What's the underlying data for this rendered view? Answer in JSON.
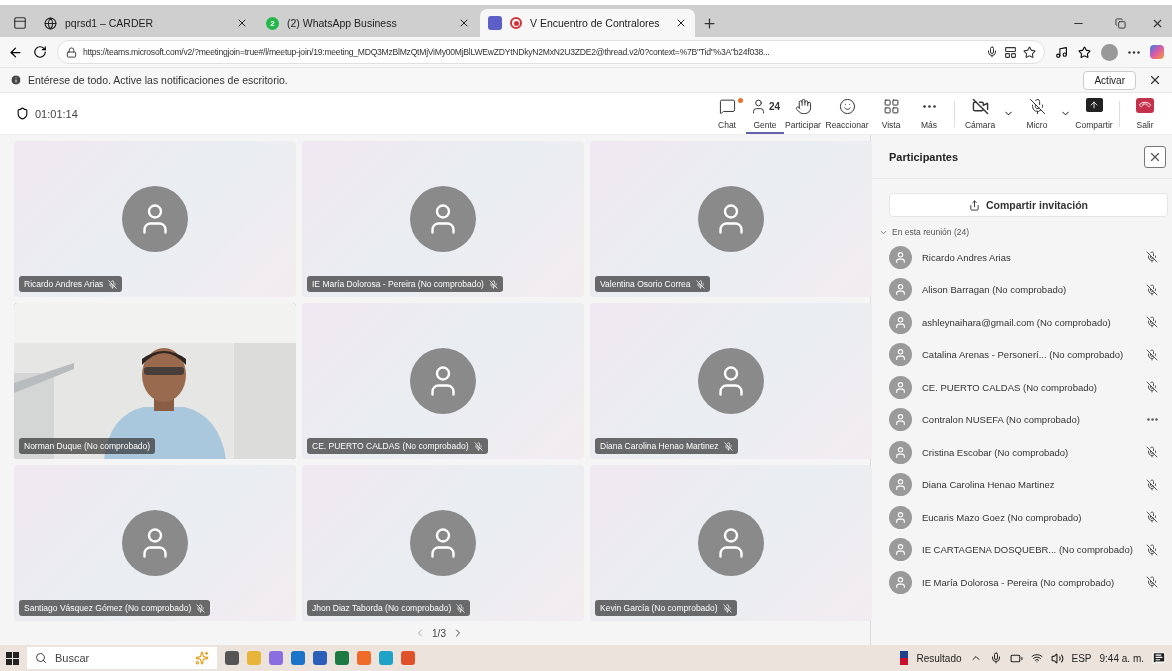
{
  "browser_tabs": [
    {
      "kind": "globe",
      "title": "pqrsd1 – CARDER",
      "selected": false
    },
    {
      "kind": "whatsapp",
      "badge": "2",
      "title": "(2) WhatsApp Business",
      "selected": false
    },
    {
      "kind": "teams",
      "title": "V Encuentro de Contralores",
      "selected": true
    }
  ],
  "address": "https://teams.microsoft.com/v2/?meetingjoin=true#/l/meetup-join/19:meeting_MDQ3MzBlMzQtMjViMy00MjBlLWEwZDYtNDkyN2MxN2U3ZDE2@thread.v2/0?context=%7B\"Tid\"%3A\"b24f038...",
  "info_bar": {
    "message": "Entérese de todo. Active las notificaciones de escritorio.",
    "button": "Activar"
  },
  "meeting": {
    "timer": "01:01:14",
    "toolbar": [
      {
        "kind": "chat",
        "label": "Chat",
        "badge": true,
        "selected": false
      },
      {
        "kind": "people",
        "label": "Gente",
        "count": "24",
        "selected": true
      },
      {
        "kind": "hand",
        "label": "Participar",
        "selected": false
      },
      {
        "kind": "react",
        "label": "Reaccionar",
        "selected": false
      },
      {
        "kind": "view",
        "label": "Vista",
        "selected": false
      },
      {
        "kind": "more",
        "label": "Más",
        "selected": false
      },
      {
        "kind": "camera",
        "label": "Cámara",
        "caret": true,
        "selected": false
      },
      {
        "kind": "mic",
        "label": "Micro",
        "caret": true,
        "selected": false
      },
      {
        "kind": "share",
        "label": "Compartir",
        "selected": false
      },
      {
        "kind": "leave",
        "label": "Salir",
        "selected": false
      }
    ]
  },
  "tiles": [
    {
      "kind": "avatar",
      "name": "Ricardo Andres Arias",
      "muted": true,
      "selected": false
    },
    {
      "kind": "avatar",
      "name": "IE María Dolorosa - Pereira (No comprobado)",
      "muted": true,
      "selected": false
    },
    {
      "kind": "avatar",
      "name": "Valentina Osorio Correa",
      "muted": true,
      "selected": false
    },
    {
      "kind": "video",
      "name": "Norman Duque (No comprobado)",
      "muted": false,
      "selected": true
    },
    {
      "kind": "avatar",
      "name": "CE. PUERTO CALDAS (No comprobado)",
      "muted": true,
      "selected": false
    },
    {
      "kind": "avatar",
      "name": "Diana Carolina Henao Martinez",
      "muted": true,
      "selected": false
    },
    {
      "kind": "avatar",
      "name": "Santiago Vásquez Gómez (No comprobado)",
      "muted": true,
      "selected": false
    },
    {
      "kind": "avatar",
      "name": "Jhon Diaz Taborda (No comprobado)",
      "muted": true,
      "selected": false
    },
    {
      "kind": "avatar",
      "name": "Kevin García (No comprobado)",
      "muted": true,
      "selected": false
    }
  ],
  "pager": "1/3",
  "panel": {
    "title": "Participantes",
    "invite": "Compartir invitación",
    "section": "En esta reunión (24)",
    "expanded": true,
    "participants": [
      {
        "name": "Ricardo Andres Arias",
        "kind": "muted"
      },
      {
        "name": "Alison Barragan (No comprobado)",
        "kind": "muted"
      },
      {
        "name": "ashleynaihara@gmail.com (No comprobado)",
        "kind": "muted"
      },
      {
        "name": "Catalina Arenas - Personerí... (No comprobado)",
        "kind": "muted"
      },
      {
        "name": "CE. PUERTO CALDAS (No comprobado)",
        "kind": "muted"
      },
      {
        "name": "Contralon NUSEFA (No comprobado)",
        "kind": "menu"
      },
      {
        "name": "Cristina Escobar (No comprobado)",
        "kind": "muted"
      },
      {
        "name": "Diana Carolina Henao Martinez",
        "kind": "muted"
      },
      {
        "name": "Eucaris Mazo Goez (No comprobado)",
        "kind": "muted"
      },
      {
        "name": "IE CARTAGENA DOSQUEBR... (No comprobado)",
        "kind": "muted"
      },
      {
        "name": "IE María Dolorosa - Pereira (No comprobado)",
        "kind": "muted"
      }
    ]
  },
  "taskbar": {
    "search": "Buscar",
    "apps": [
      {
        "kind": "taskview"
      },
      {
        "kind": "files"
      },
      {
        "kind": "copilot"
      },
      {
        "kind": "outlook"
      },
      {
        "kind": "word"
      },
      {
        "kind": "excel"
      },
      {
        "kind": "firefox"
      },
      {
        "kind": "edge"
      },
      {
        "kind": "brave"
      }
    ],
    "news": "Resultado",
    "language": "ESP",
    "time": "9:44 a. m."
  }
}
